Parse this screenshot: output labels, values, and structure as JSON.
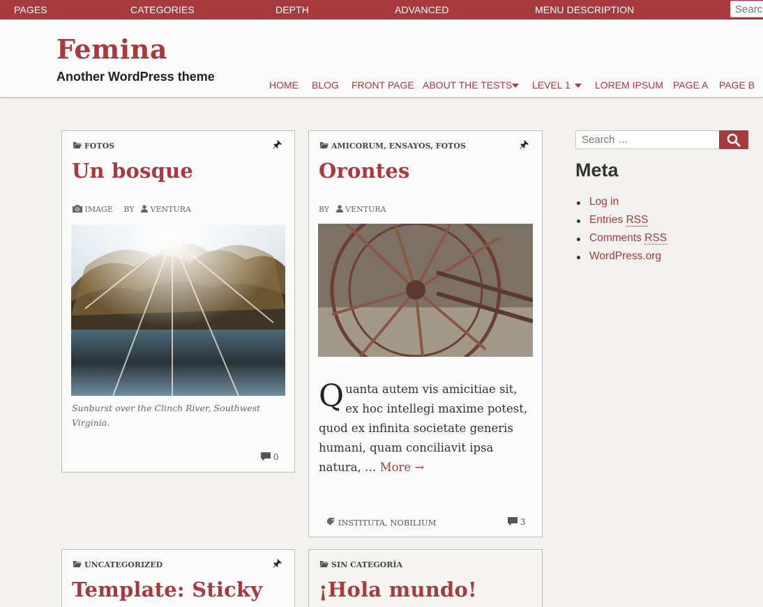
{
  "topbar": {
    "items": [
      "PAGES",
      "CATEGORIES",
      "DEPTH",
      "ADVANCED",
      "MENU DESCRIPTION"
    ],
    "search_placeholder": "Search"
  },
  "site": {
    "title": "Femina",
    "description": "Another WordPress theme"
  },
  "nav": {
    "items": [
      "HOME",
      "BLOG",
      "FRONT PAGE",
      "ABOUT THE TESTS",
      "LEVEL 1",
      "LOREM IPSUM",
      "PAGE A",
      "PAGE B"
    ]
  },
  "posts": [
    {
      "categories": "FOTOS",
      "title": "Un bosque",
      "format": "IMAGE",
      "by": "BY",
      "author": "VENTURA",
      "caption": "Sunburst over the Clinch River, Southwest Virginia.",
      "comments": "0"
    },
    {
      "categories": "AMICORUM, ENSAYOS, FOTOS",
      "title": "Orontes",
      "by": "BY",
      "author": "VENTURA",
      "excerpt_dropcap": "Q",
      "excerpt": "uanta autem vis amicitiae sit, ex hoc intellegi maxime potest, quod ex infinita societate generis humani, quam conciliavit ipsa natura, …",
      "more": "More →",
      "tags": "INSTITUTA, NOBILIUM",
      "comments": "3"
    },
    {
      "categories": "UNCATEGORIZED",
      "title": "Template: Sticky"
    },
    {
      "categories": "SIN CATEGORÍA",
      "title": "¡Hola mundo!"
    }
  ],
  "sidebar": {
    "search_placeholder": "Search …",
    "meta_title": "Meta",
    "links": [
      "Log in",
      "Entries RSS",
      "Comments RSS",
      "WordPress.org"
    ]
  },
  "colors": {
    "accent": "#a63a3f",
    "background": "#f2f1ed"
  }
}
